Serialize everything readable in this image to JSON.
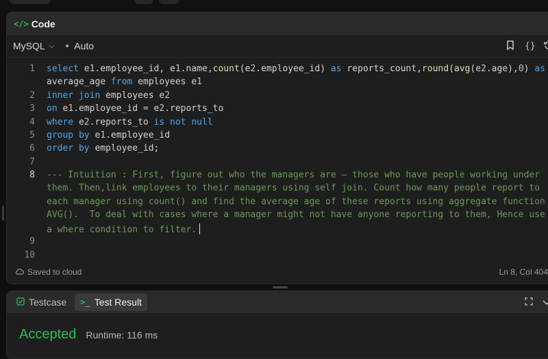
{
  "panel": {
    "title": "Code"
  },
  "toolbar": {
    "language": "MySQL",
    "mode": "Auto"
  },
  "editor": {
    "lines": [
      {
        "num": "1",
        "text": "select e1.employee_id, e1.name,count(e2.employee_id) as reports_count,round(avg(e2.age),0) as"
      },
      {
        "num": "",
        "text": "average_age from employees e1"
      },
      {
        "num": "2",
        "text": "inner join employees e2"
      },
      {
        "num": "3",
        "text": "on e1.employee_id = e2.reports_to"
      },
      {
        "num": "4",
        "text": "where e2.reports_to is not null"
      },
      {
        "num": "5",
        "text": "group by e1.employee_id"
      },
      {
        "num": "6",
        "text": "order by employee_id;"
      },
      {
        "num": "7",
        "text": ""
      },
      {
        "num": "8",
        "text": "--- Intuition : First, figure out who the managers are – those who have people working under"
      },
      {
        "num": "",
        "text": "them. Then,link employees to their managers using self join. Count how many people report to"
      },
      {
        "num": "",
        "text": "each manager using count() and find the average age of these reports using aggregate function"
      },
      {
        "num": "",
        "text": "AVG().  To deal with cases where a manager might not have anyone reporting to them, Hence use"
      },
      {
        "num": "",
        "text": "a where condition to filter."
      },
      {
        "num": "9",
        "text": ""
      },
      {
        "num": "10",
        "text": ""
      }
    ]
  },
  "footer": {
    "saved": "Saved to cloud",
    "position": "Ln 8, Col 404"
  },
  "result_panel": {
    "tabs": [
      {
        "label": "Testcase"
      },
      {
        "label": "Test Result"
      }
    ],
    "status": "Accepted",
    "runtime": "Runtime: 116 ms"
  },
  "colors": {
    "accent": "#2cbb5d",
    "keyword": "#4fa6ec",
    "function": "#dcdcaa",
    "comment": "#6a9955"
  }
}
